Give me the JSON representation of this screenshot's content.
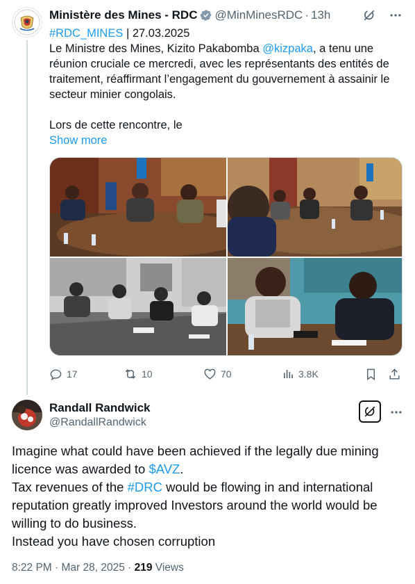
{
  "tweet1": {
    "author_name": "Ministère des Mines - RDC",
    "handle": "@MinMinesRDC",
    "separator": "·",
    "time": "13h",
    "line1_tag": "#RDC_MINES",
    "line1_rest": " | 27.03.2025",
    "body_part1": "Le Ministre des Mines, Kizito Pakabomba ",
    "body_mention": "@kizpaka",
    "body_part2": ", a tenu une réunion cruciale ce mercredi, avec les représentants des entités de traitement, réaffirmant l’engagement du gouvernement à assainir le secteur minier congolais.",
    "body_para2": "Lors de cette rencontre, le",
    "show_more": "Show more",
    "stats": {
      "replies": "17",
      "reposts": "10",
      "likes": "70",
      "views": "3.8K"
    }
  },
  "tweet2": {
    "author_name": "Randall Randwick",
    "handle": "@RandallRandwick",
    "line1": "Imagine what could have been achieved if the legally due mining licence was awarded to ",
    "cashtag": "$AVZ",
    "line1_end": ".",
    "line2_start": "Tax revenues of the ",
    "hashtag": "#DRC",
    "line2_rest": " would be flowing in and international reputation greatly improved Investors  around the world would be willing to do business.",
    "line3": "Instead you have chosen corruption",
    "timestamp": "8:22 PM · Mar 28, 2025 · ",
    "views_count": "219",
    "views_label": " Views"
  },
  "colors": {
    "accent": "#1d9bf0",
    "muted": "#536471",
    "verified_gray": "#829aab"
  }
}
